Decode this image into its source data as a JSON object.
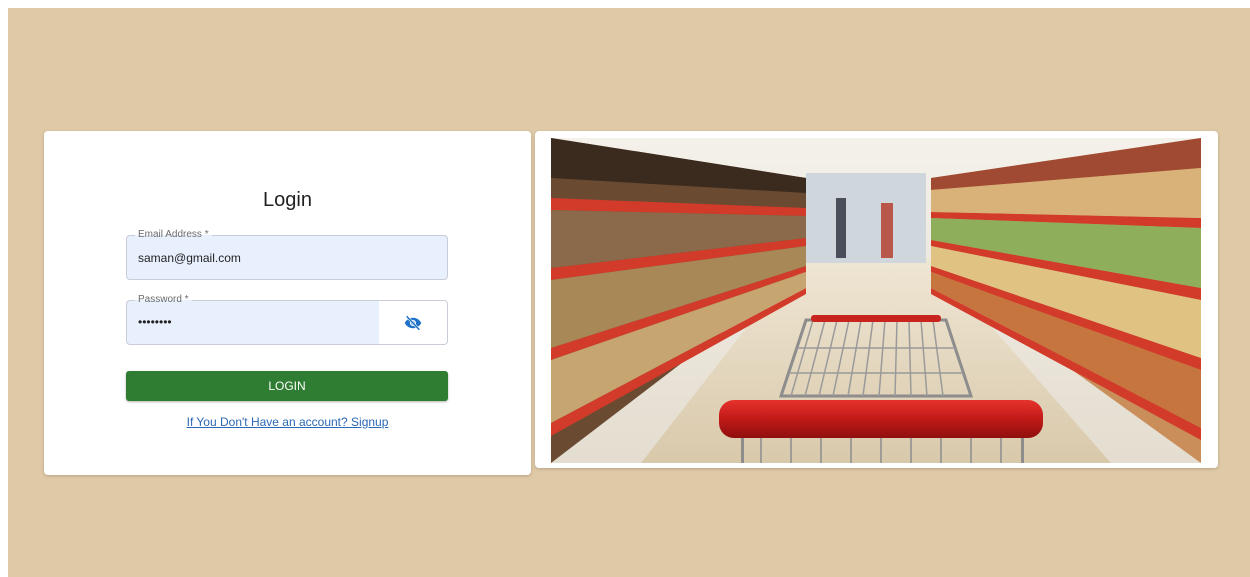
{
  "login": {
    "title": "Login",
    "email_label": "Email Address *",
    "email_value": "saman@gmail.com",
    "password_label": "Password *",
    "password_value": "••••••••",
    "login_button": "LOGIN",
    "signup_link": "If You Don't Have an account? Signup"
  },
  "icons": {
    "password_toggle": "eye-slash-icon"
  },
  "colors": {
    "page_background": "#dfc9a6",
    "primary_button": "#2e7d32",
    "input_fill": "#e8f0fe",
    "link": "#2a68b3",
    "icon": "#1e73c8"
  }
}
